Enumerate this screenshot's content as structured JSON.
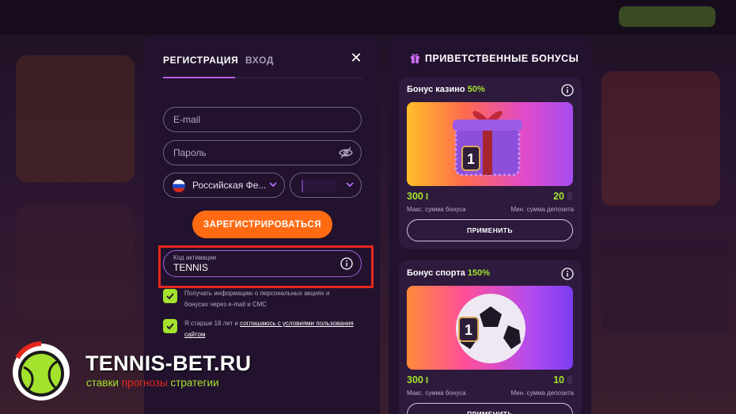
{
  "register_panel": {
    "tab_register": "РЕГИСТРАЦИЯ",
    "tab_login": "ВХОД",
    "email_placeholder": "E-mail",
    "password_placeholder": "Пароль",
    "country_value": "Российская Фе...",
    "register_button": "ЗАРЕГИСТРИРОВАТЬСЯ",
    "activation_code_label": "Код активации",
    "activation_code_value": "TENNIS",
    "consent_promo": "Получать информацию о персональных акциях и бонусах через e-mail и СМС",
    "consent_age_prefix": "Я старше 18 лет и ",
    "consent_age_link": "соглашаюсь с условиями пользования сайтом"
  },
  "bonus_panel": {
    "title": "ПРИВЕТСТВЕННЫЕ БОНУСЫ",
    "cards": [
      {
        "title": "Бонус казино",
        "percent": "50%",
        "max_amount": "300",
        "max_label": "Макс. сумма бонуса",
        "min_deposit": "20",
        "min_label": "Мин. сумма депозита",
        "apply": "ПРИМЕНИТЬ"
      },
      {
        "title": "Бонус спорта",
        "percent": "150%",
        "max_amount": "300",
        "max_label": "Макс. сумма бонуса",
        "min_deposit": "10",
        "min_label": "Мин. сумма депозита",
        "apply": "ПРИМЕНИТЬ"
      }
    ]
  },
  "watermark": {
    "name": "TENNIS-BET.RU",
    "tag_1": "ставки",
    "tag_2": "прогнозы",
    "tag_3": "стратегии"
  },
  "colors": {
    "accent_green": "#a3e22d",
    "accent_orange": "#ff6a12",
    "highlight_red": "#e5271d",
    "panel_bg": "#22122e"
  }
}
